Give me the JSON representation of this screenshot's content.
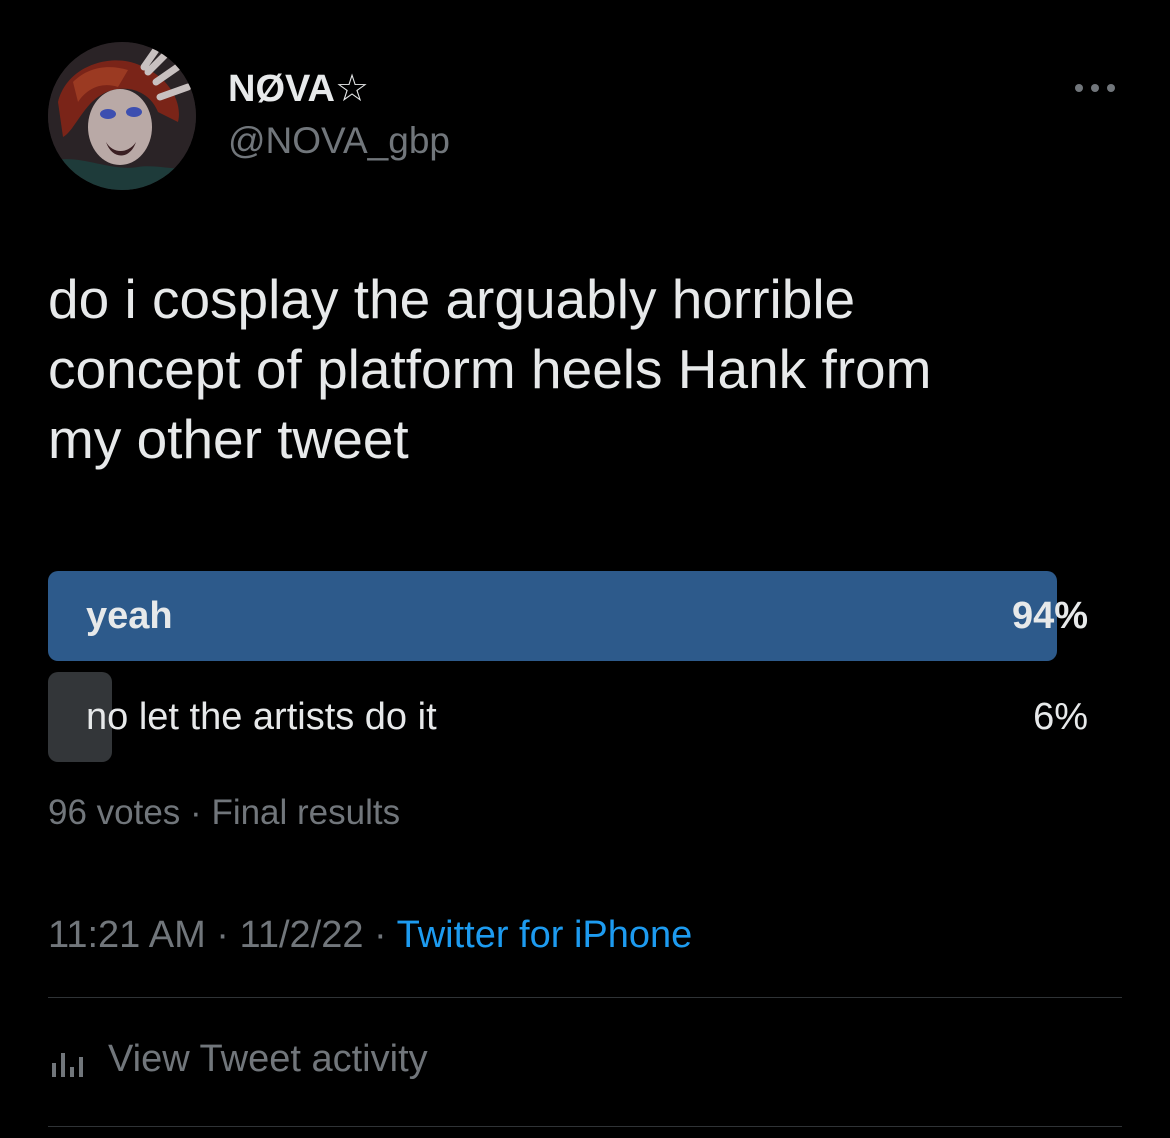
{
  "author": {
    "display_name": "NØVA☆",
    "handle": "@NOVA_gbp"
  },
  "tweet": {
    "text": "do i cosplay the arguably horrible\nconcept of platform heels Hank from\nmy other tweet"
  },
  "poll": {
    "options": [
      {
        "label": "yeah",
        "percent_text": "94%",
        "fill": 0.97,
        "winner": true
      },
      {
        "label": "no let the artists do it",
        "percent_text": "6%",
        "fill": 0.062,
        "winner": false
      }
    ],
    "votes": "96 votes",
    "separator": "·",
    "status": "Final results"
  },
  "meta": {
    "time": "11:21 AM",
    "separator": "·",
    "date": "11/2/22",
    "source": "Twitter for iPhone"
  },
  "activity": {
    "label": "View Tweet activity",
    "icon": "bar-chart-icon"
  },
  "colors": {
    "background": "#000000",
    "primary_text": "#e7e9ea",
    "secondary_text": "#71767b",
    "link": "#1d9bf0",
    "poll_winner_fill": "#2d5a8b",
    "poll_loser_fill": "#333639",
    "divider": "#2f3336"
  }
}
